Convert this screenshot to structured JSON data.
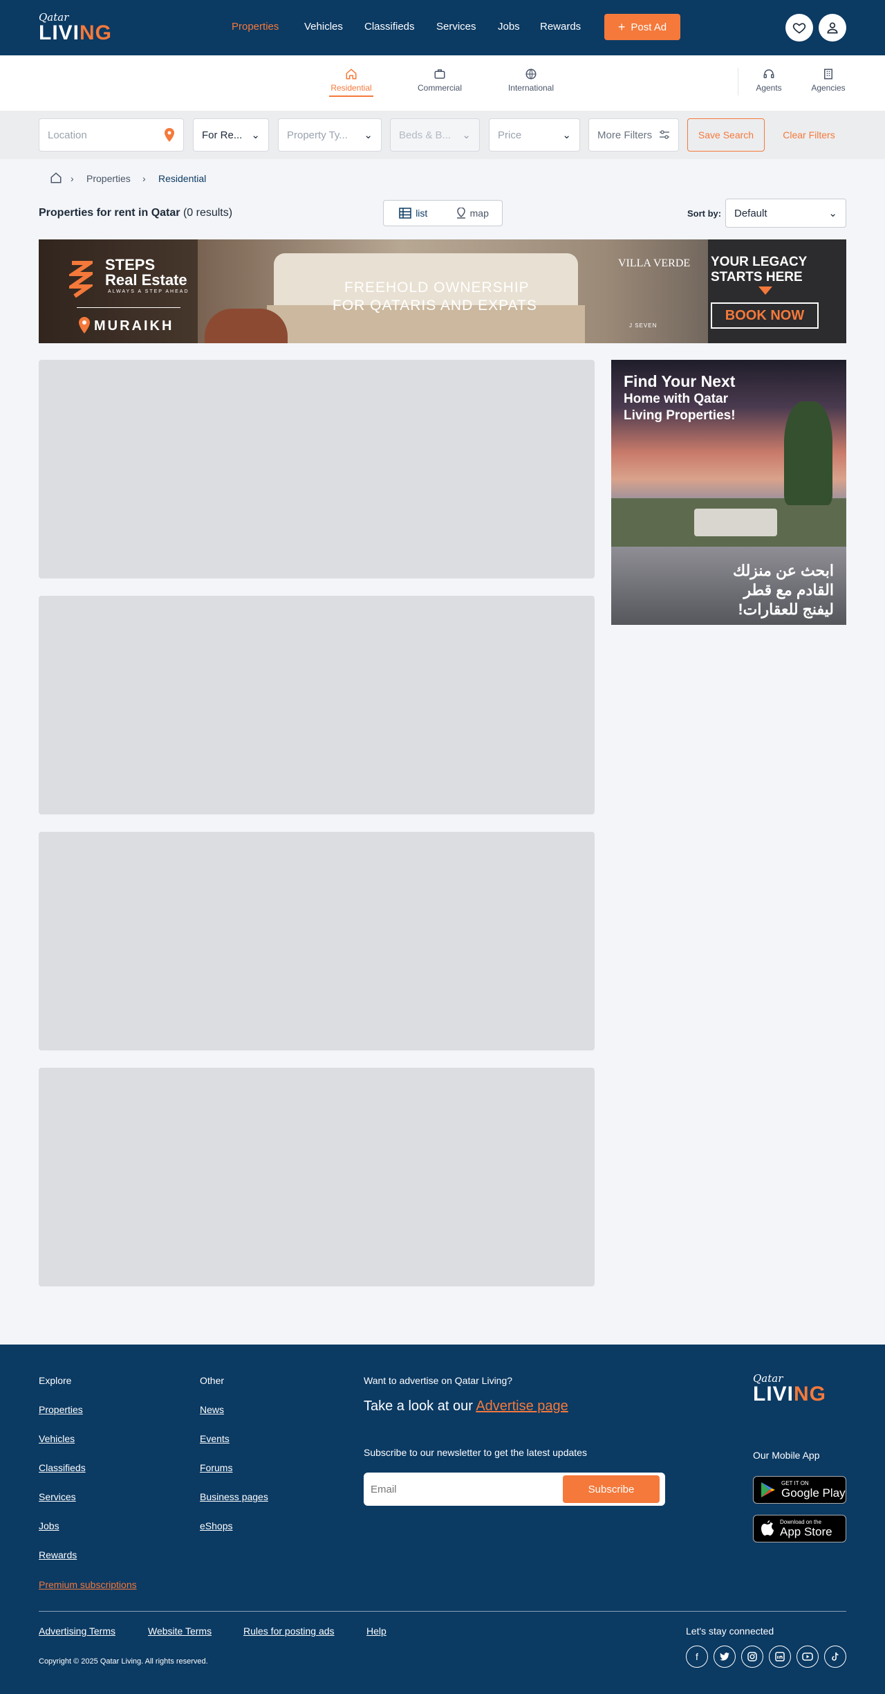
{
  "header": {
    "logo_small": "Qatar",
    "logo_main_a": "LIVI",
    "logo_main_b": "NG",
    "nav": [
      "Properties",
      "Vehicles",
      "Classifieds",
      "Services",
      "Jobs",
      "Rewards"
    ],
    "post_ad_label": "Post Ad"
  },
  "subnav": {
    "tabs": [
      "Residential",
      "Commercial",
      "International"
    ],
    "right": [
      "Agents",
      "Agencies"
    ]
  },
  "filters": {
    "location_placeholder": "Location",
    "for_rent": "For Re...",
    "property_type": "Property Ty...",
    "beds_baths": "Beds & B...",
    "price": "Price",
    "more_filters": "More Filters",
    "save_search": "Save Search",
    "clear_filters": "Clear Filters"
  },
  "breadcrumb": [
    "Properties",
    "Residential"
  ],
  "results": {
    "title_bold": "Properties for rent in Qatar",
    "count": "(0 results)",
    "view_list": "list",
    "view_map": "map",
    "sort_label": "Sort by:",
    "sort_value": "Default"
  },
  "banner": {
    "brand_line1": "STEPS",
    "brand_line2": "Real Estate",
    "tagline": "ALWAYS A STEP AHEAD",
    "project": "MURAIKH",
    "headline1": "FREEHOLD OWNERSHIP",
    "headline2": "FOR QATARIS AND EXPATS",
    "villa": "VILLA VERDE",
    "seven": "J SEVEN",
    "legacy1": "YOUR LEGACY",
    "legacy2": "STARTS HERE",
    "cta": "BOOK NOW"
  },
  "side_ad": {
    "line1": "Find Your Next",
    "line2": "Home with Qatar",
    "line3": "Living Properties!",
    "ar1": "ابحث عن منزلك",
    "ar2": "القادم مع قطر",
    "ar3": "ليفنج للعقارات!"
  },
  "footer": {
    "explore_heading": "Explore",
    "explore": [
      "Properties",
      "Vehicles",
      "Classifieds",
      "Services",
      "Jobs",
      "Rewards"
    ],
    "premium": "Premium subscriptions",
    "other_heading": "Other",
    "other": [
      "News",
      "Events",
      "Forums",
      "Business pages",
      "eShops"
    ],
    "advertise_q": "Want to advertise on Qatar Living?",
    "advertise_text": "Take a look at our",
    "advertise_link": "Advertise page",
    "newsletter_heading": "Subscribe to our newsletter to get the latest updates",
    "email_placeholder": "Email",
    "subscribe": "Subscribe",
    "mobile_app": "Our Mobile App",
    "google_small": "GET IT ON",
    "google_big": "Google Play",
    "apple_small": "Download on the",
    "apple_big": "App Store",
    "legal": [
      "Advertising Terms",
      "Website Terms",
      "Rules for posting ads",
      "Help"
    ],
    "connected": "Let's stay connected",
    "copyright": "Copyright © 2025 Qatar Living. All rights reserved."
  },
  "colors": {
    "navy": "#0b3a63",
    "accent": "#f4793b",
    "skeleton": "#dcdde1"
  }
}
